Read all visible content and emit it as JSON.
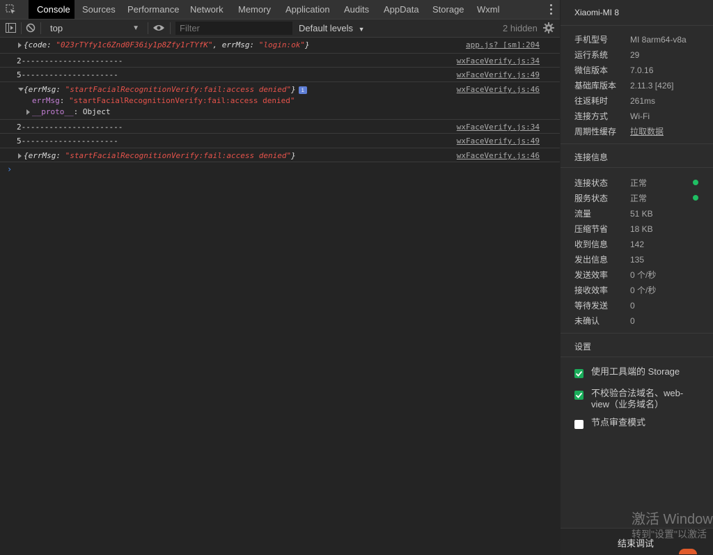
{
  "tabs": [
    "Console",
    "Sources",
    "Performance",
    "Network",
    "Memory",
    "Application",
    "Audits",
    "AppData",
    "Storage",
    "Wxml"
  ],
  "toolbar": {
    "context": "top",
    "filter_placeholder": "Filter",
    "levels": "Default levels",
    "hidden": "2 hidden"
  },
  "console": {
    "rows": [
      {
        "prefix": "{code: ",
        "val1": "\"023rTYfy1c6Znd0F36iy1p8Zfy1rTYfK\"",
        "mid": ", errMsg: ",
        "val2": "\"login:ok\"",
        "suffix": "}",
        "src": "app.js? [sm]:204"
      },
      {
        "text": "2----------------------",
        "src": "wxFaceVerify.js:34"
      },
      {
        "text": "5---------------------",
        "src": "wxFaceVerify.js:49"
      },
      {
        "prefix": "{errMsg: ",
        "val": "\"startFacialRecognitionVerify:fail:access denied\"",
        "suffix": "}",
        "badge": "i",
        "src": "wxFaceVerify.js:46",
        "child_key": "errMsg",
        "child_val": "\"startFacialRecognitionVerify:fail:access denied\"",
        "proto_key": "__proto__",
        "proto_val": ": Object"
      },
      {
        "text": "2----------------------",
        "src": "wxFaceVerify.js:34"
      },
      {
        "text": "5---------------------",
        "src": "wxFaceVerify.js:49"
      },
      {
        "prefix": "{errMsg: ",
        "val": "\"startFacialRecognitionVerify:fail:access denied\"",
        "suffix": "}",
        "src": "wxFaceVerify.js:46"
      }
    ],
    "prompt": "›"
  },
  "device": {
    "title": "Xiaomi-MI 8",
    "info": [
      {
        "k": "手机型号",
        "v": "MI 8arm64-v8a"
      },
      {
        "k": "运行系统",
        "v": "29"
      },
      {
        "k": "微信版本",
        "v": "7.0.16"
      },
      {
        "k": "基础库版本",
        "v": "2.11.3 [426]"
      },
      {
        "k": "往返耗时",
        "v": "261ms"
      },
      {
        "k": "连接方式",
        "v": "Wi-Fi"
      },
      {
        "k": "周期性缓存",
        "v": "拉取数据"
      }
    ],
    "conn_title": "连接信息",
    "conn": [
      {
        "k": "连接状态",
        "v": "正常"
      },
      {
        "k": "服务状态",
        "v": "正常"
      },
      {
        "k": "流量",
        "v": "51 KB"
      },
      {
        "k": "压缩节省",
        "v": "18 KB"
      },
      {
        "k": "收到信息",
        "v": "142"
      },
      {
        "k": "发出信息",
        "v": "135"
      },
      {
        "k": "发送效率",
        "v": "0 个/秒"
      },
      {
        "k": "接收效率",
        "v": "0 个/秒"
      },
      {
        "k": "等待发送",
        "v": "0"
      },
      {
        "k": "未确认",
        "v": "0"
      }
    ],
    "settings_title": "设置",
    "settings": [
      {
        "label": "使用工具端的 Storage",
        "checked": true
      },
      {
        "label": "不校验合法域名、web-view（业务域名）",
        "checked": true
      },
      {
        "label": "节点审查模式",
        "checked": false
      }
    ],
    "watermark_line1": "激活 Windows",
    "watermark_line2": "转到\"设置\"以激活",
    "end_button": "结束调试"
  },
  "colors": {
    "accent_green": "#1aad5a",
    "link_blue": "#3b87f0",
    "string_red": "#e6534b"
  }
}
